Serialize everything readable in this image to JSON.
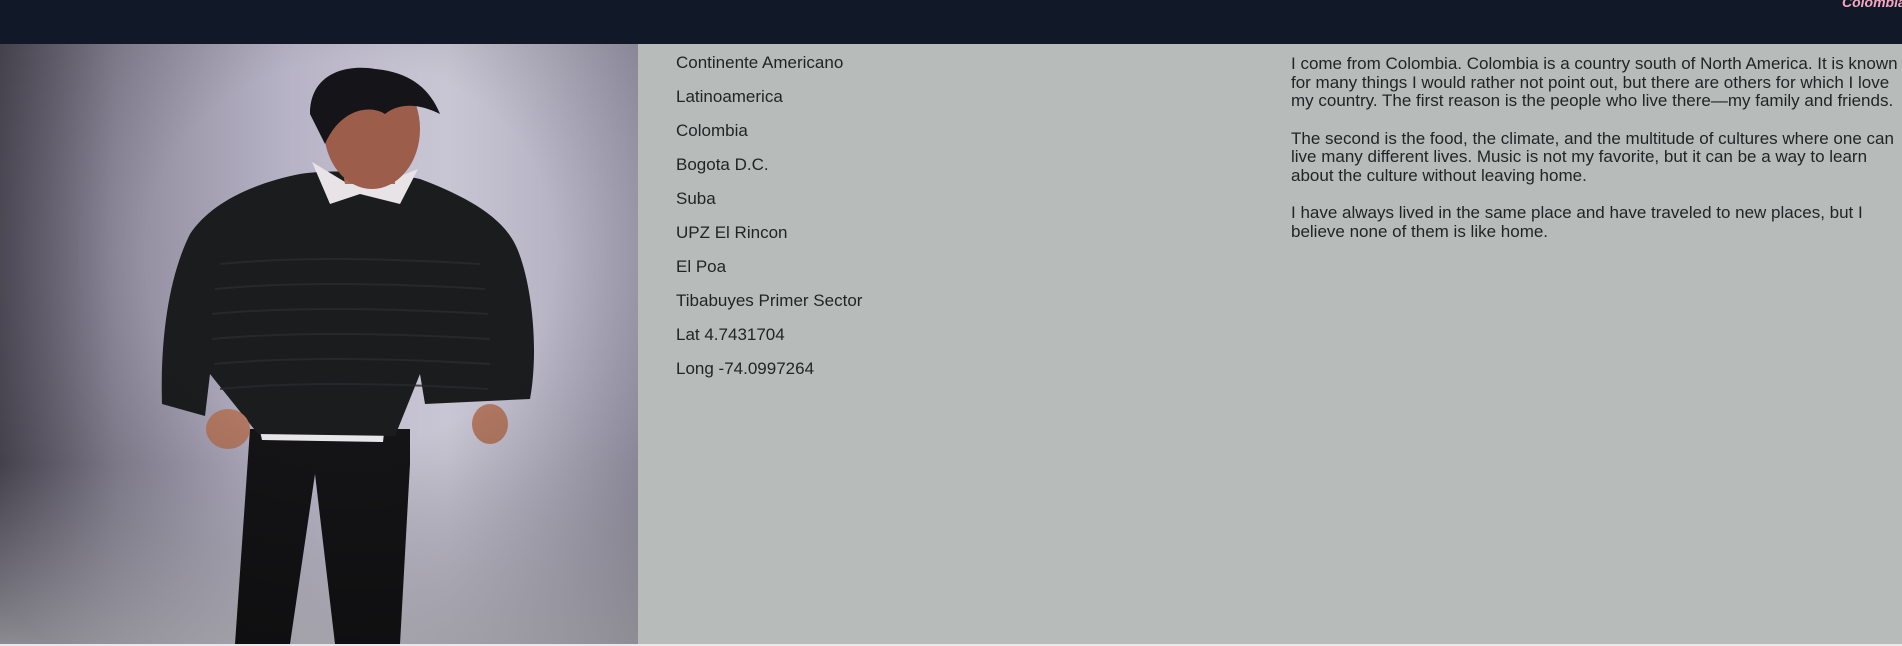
{
  "header": {
    "brand": "Colombia",
    "colors": {
      "bar": "#111827",
      "brand": "#f2a9c0"
    }
  },
  "photo": {
    "subject": "portrait-photo",
    "icon": "person-photo"
  },
  "places": [
    "Continente Americano",
    "Latinoamerica",
    "Colombia",
    "Bogota D.C.",
    "Suba",
    "UPZ El Rincon",
    "El Poa",
    "Tibabuyes Primer Sector",
    "Lat 4.7431704",
    "Long -74.0997264"
  ],
  "story": {
    "paragraphs": [
      "I come from Colombia. Colombia is a country south of North America. It is known for many things I would rather not point out, but there are others for which I love my country. The first reason is the people who live there—my family and friends.",
      "The second is the food, the climate, and the multitude of cultures where one can live many different lives. Music is not my favorite, but it can be a way to learn about the culture without leaving home.",
      "I have always lived in the same place and have traveled to new places, but I believe none of them is like home."
    ]
  },
  "colors": {
    "background": "#b7bbb9",
    "text": "#1f2424"
  }
}
